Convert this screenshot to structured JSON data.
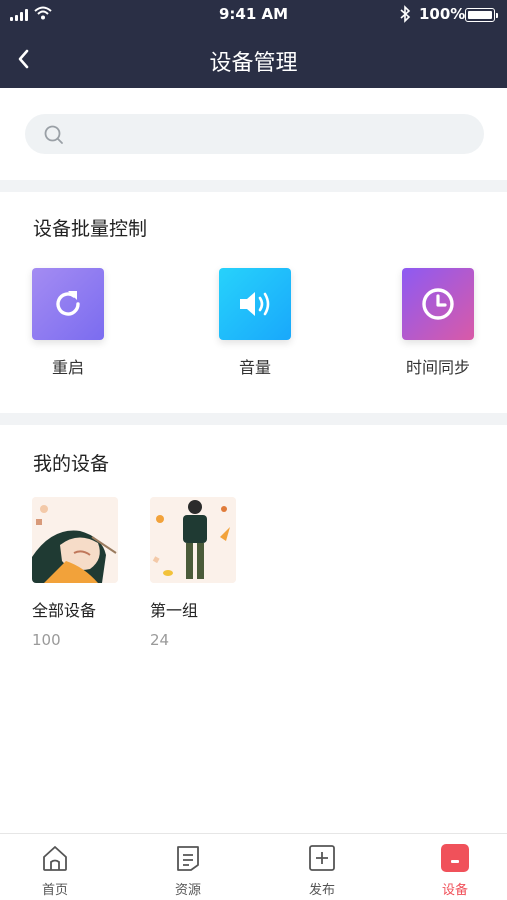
{
  "status_bar": {
    "time": "9:41 AM",
    "battery": "100%"
  },
  "nav": {
    "title": "设备管理",
    "back_icon": "chevron-left-icon"
  },
  "search": {
    "placeholder": "",
    "value": "",
    "icon": "search-icon"
  },
  "batch_control": {
    "title": "设备批量控制",
    "items": [
      {
        "label": "重启",
        "icon": "refresh-icon",
        "gradient": [
          "#a48cf2",
          "#7b6cf0"
        ]
      },
      {
        "label": "音量",
        "icon": "volume-icon",
        "gradient": [
          "#27d2fb",
          "#19a8fb"
        ]
      },
      {
        "label": "时间同步",
        "icon": "clock-icon",
        "gradient": [
          "#8d5af3",
          "#d95aa7"
        ]
      }
    ]
  },
  "my_devices": {
    "title": "我的设备",
    "groups": [
      {
        "name": "全部设备",
        "count": "100"
      },
      {
        "name": "第一组",
        "count": "24"
      }
    ]
  },
  "tab_bar": {
    "active_color": "#f0515a",
    "tabs": [
      {
        "label": "首页",
        "icon": "home-icon",
        "active": false
      },
      {
        "label": "资源",
        "icon": "document-icon",
        "active": false
      },
      {
        "label": "发布",
        "icon": "plus-square-icon",
        "active": false
      },
      {
        "label": "设备",
        "icon": "device-icon",
        "active": true
      }
    ]
  }
}
